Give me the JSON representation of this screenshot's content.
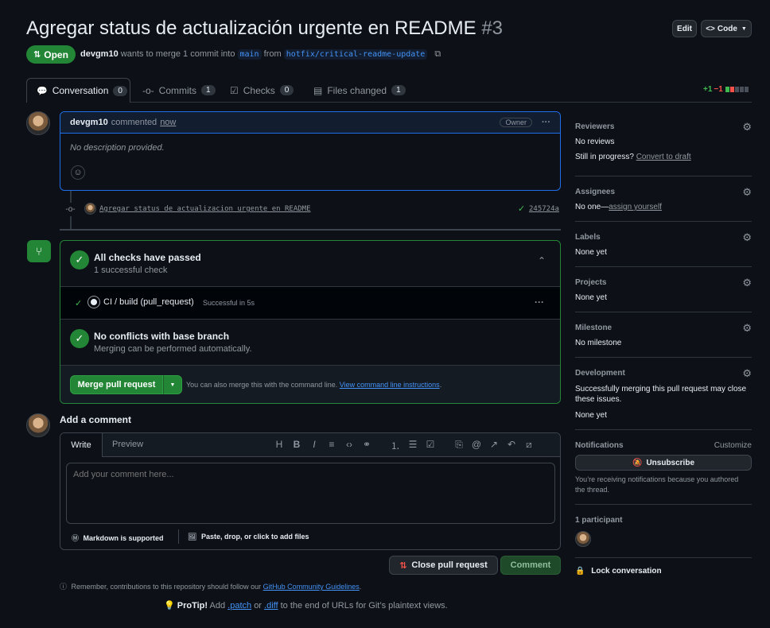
{
  "header": {
    "title": "Agregar status de actualización urgente en README",
    "number": "#3",
    "edit_label": "Edit",
    "code_label": "Code"
  },
  "pr_meta": {
    "state": "Open",
    "author": "devgm10",
    "text1": "wants to merge 1 commit into",
    "base": "main",
    "text2": "from",
    "head": "hotfix/critical-readme-update"
  },
  "tabs": [
    {
      "label": "Conversation",
      "count": "0"
    },
    {
      "label": "Commits",
      "count": "1"
    },
    {
      "label": "Checks",
      "count": "0"
    },
    {
      "label": "Files changed",
      "count": "1"
    }
  ],
  "diffstat": {
    "added": "+1",
    "removed": "−1"
  },
  "comment": {
    "author": "devgm10",
    "action": "commented",
    "time": "now",
    "badge": "Owner",
    "body": "No description provided."
  },
  "commit": {
    "message": "Agregar status de actualizacion urgente en README",
    "sha": "245724a"
  },
  "merge_box": {
    "checks_title": "All checks have passed",
    "checks_sub": "1 successful check",
    "ci_name": "CI / build (pull_request)",
    "ci_status": "Successful in 5s",
    "conflict_title": "No conflicts with base branch",
    "conflict_sub": "Merging can be performed automatically.",
    "merge_label": "Merge pull request",
    "cli_text": "You can also merge this with the command line.",
    "cli_link": "View command line instructions",
    "cli_end": "."
  },
  "add_comment": {
    "title": "Add a comment",
    "write_tab": "Write",
    "preview_tab": "Preview",
    "placeholder": "Add your comment here...",
    "markdown_note": "Markdown is supported",
    "attach_note": "Paste, drop, or click to add files",
    "close_label": "Close pull request",
    "comment_label": "Comment",
    "reminder_text": "Remember, contributions to this repository should follow our",
    "reminder_link": "GitHub Community Guidelines",
    "reminder_end": ".",
    "protip_label": "ProTip!",
    "protip_1": "Add",
    "protip_patch": ".patch",
    "protip_2": "or",
    "protip_diff": ".diff",
    "protip_3": "to the end of URLs for Git’s plaintext views."
  },
  "sidebar": {
    "reviewers_h": "Reviewers",
    "reviewers_v": "No reviews",
    "in_progress": "Still in progress?",
    "draft_link": "Convert to draft",
    "assignees_h": "Assignees",
    "assignees_v": "No one—",
    "assign_link": "assign yourself",
    "labels_h": "Labels",
    "labels_v": "None yet",
    "projects_h": "Projects",
    "projects_v": "None yet",
    "milestone_h": "Milestone",
    "milestone_v": "No milestone",
    "development_h": "Development",
    "development_text": "Successfully merging this pull request may close these issues.",
    "development_v": "None yet",
    "notifications_h": "Notifications",
    "customize": "Customize",
    "unsubscribe": "Unsubscribe",
    "notif_text": "You’re receiving notifications because you authored the thread.",
    "participants_h": "1 participant",
    "lock": "Lock conversation"
  },
  "colors": {
    "accent": "#4493f8",
    "success": "#238636",
    "danger": "#f85149"
  }
}
